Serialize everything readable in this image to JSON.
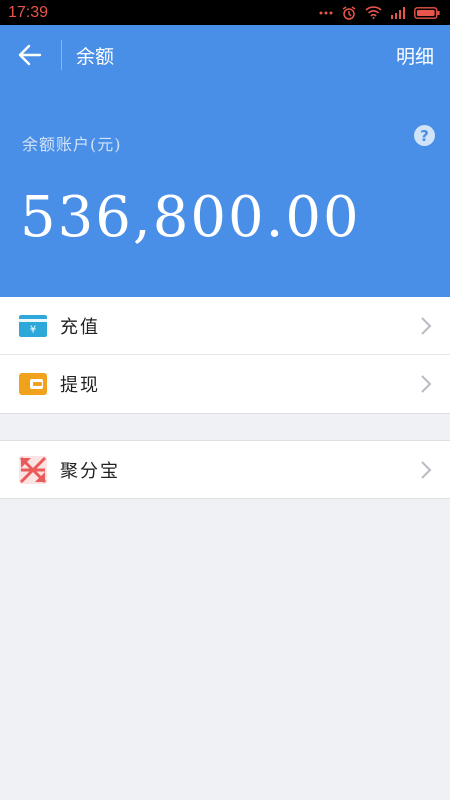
{
  "status_bar": {
    "time": "17:39",
    "icons": [
      "dots-icon",
      "alarm-icon",
      "wifi-icon",
      "signal-icon",
      "battery-icon"
    ]
  },
  "nav": {
    "back_icon": "back-arrow-icon",
    "title": "余额",
    "detail_label": "明细"
  },
  "account": {
    "label": "余额账户(元)",
    "balance": "536,800.00",
    "help_icon": "question-icon"
  },
  "menu": {
    "recharge": {
      "label": "充值",
      "icon": "card-yuan-icon",
      "color": "#2ea8d8"
    },
    "withdraw": {
      "label": "提现",
      "icon": "wallet-icon",
      "color": "#f0a21d"
    },
    "jufenbao": {
      "label": "聚分宝",
      "icon": "jufenbao-logo-icon",
      "color": "#ea5a5a"
    }
  },
  "colors": {
    "header_bg": "#4a8fe7",
    "page_bg": "#eff1f5",
    "status_text": "#e8554a"
  }
}
